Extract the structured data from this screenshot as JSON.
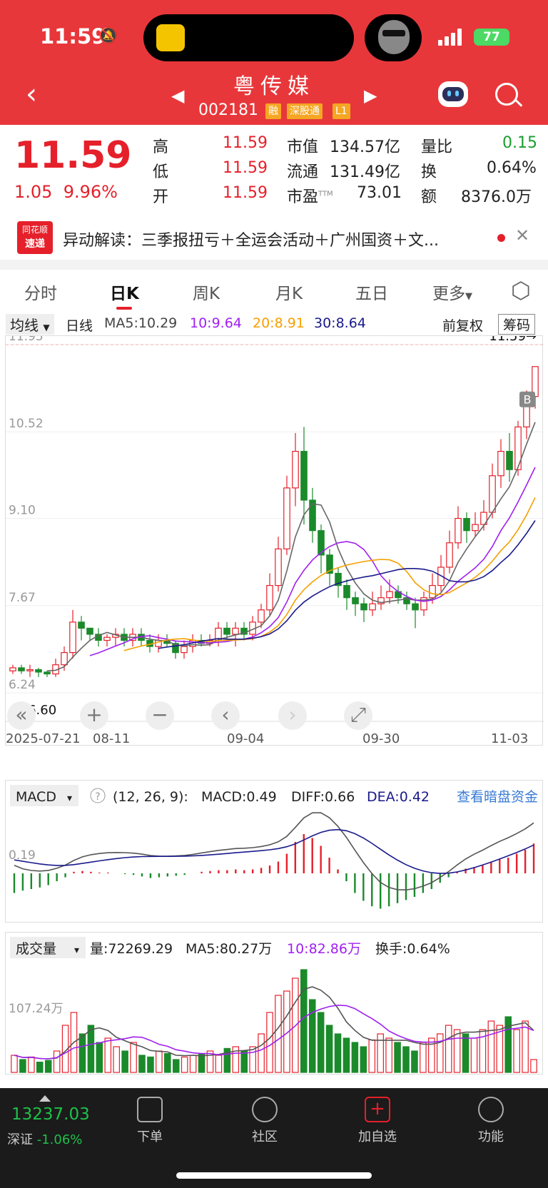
{
  "status": {
    "time": "11:59",
    "battery": "77"
  },
  "header": {
    "title": "粤传媒",
    "code": "002181",
    "tags": [
      "融",
      "深股通",
      "L1"
    ]
  },
  "quote": {
    "price": "11.59",
    "change": "1.05",
    "change_pct": "9.96%",
    "rows": [
      {
        "k1": "高",
        "v1": "11.59",
        "k2": "市值",
        "v2": "134.57亿",
        "k3": "量比",
        "v3": "0.15"
      },
      {
        "k1": "低",
        "v1": "11.59",
        "k2": "流通",
        "v2": "131.49亿",
        "k3": "换",
        "v3": "0.64%"
      },
      {
        "k1": "开",
        "v1": "11.59",
        "k2": "市盈",
        "k2sup": "TTM",
        "v2": "73.01",
        "k3": "额",
        "v3": "8376.0万"
      }
    ]
  },
  "news": {
    "logo_top": "同花顺",
    "logo_bottom": "速递",
    "text": "异动解读：三季报扭亏＋全运会活动＋广州国资＋文..."
  },
  "tabs": [
    "分时",
    "日K",
    "周K",
    "月K",
    "五日",
    "更多"
  ],
  "active_tab": "日K",
  "ma": {
    "selector": "均线",
    "period": "日线",
    "ma5": "MA5:10.29",
    "ma10": "10:9.64",
    "ma20": "20:8.91",
    "ma30": "30:8.64",
    "adjust": "前复权",
    "chips": "筹码"
  },
  "colors": {
    "up": "#e5202a",
    "down": "#1a8a2a",
    "ma5": "#666666",
    "ma10": "#a020f0",
    "ma20": "#f5a000",
    "ma30": "#1a1a8c"
  },
  "chart_data": {
    "type": "candlestick",
    "y_labels": [
      "11.95",
      "10.52",
      "9.10",
      "7.67",
      "6.24"
    ],
    "ylim": [
      6.24,
      11.95
    ],
    "last_price_label": "11.59→",
    "low_label": "←6.60",
    "dates": [
      "2025-07-21",
      "08-11",
      "09-04",
      "09-30",
      "11-03"
    ],
    "marker": "B",
    "candles": [
      [
        6.6,
        6.65,
        6.55,
        6.7
      ],
      [
        6.65,
        6.6,
        6.55,
        6.7
      ],
      [
        6.6,
        6.62,
        6.5,
        6.7
      ],
      [
        6.62,
        6.58,
        6.5,
        6.65
      ],
      [
        6.58,
        6.55,
        6.5,
        6.6
      ],
      [
        6.55,
        6.7,
        6.5,
        6.8
      ],
      [
        6.7,
        6.9,
        6.6,
        7.0
      ],
      [
        6.9,
        7.4,
        6.8,
        7.6
      ],
      [
        7.4,
        7.3,
        7.1,
        7.5
      ],
      [
        7.3,
        7.2,
        7.1,
        7.3
      ],
      [
        7.2,
        7.1,
        7.0,
        7.3
      ],
      [
        7.1,
        7.15,
        7.0,
        7.2
      ],
      [
        7.15,
        7.2,
        7.0,
        7.3
      ],
      [
        7.2,
        7.1,
        7.0,
        7.3
      ],
      [
        7.1,
        7.2,
        7.0,
        7.3
      ],
      [
        7.2,
        7.1,
        7.0,
        7.3
      ],
      [
        7.1,
        7.0,
        6.9,
        7.2
      ],
      [
        7.0,
        7.1,
        6.9,
        7.2
      ],
      [
        7.1,
        7.05,
        7.0,
        7.2
      ],
      [
        7.05,
        6.9,
        6.8,
        7.1
      ],
      [
        6.9,
        7.0,
        6.8,
        7.1
      ],
      [
        7.0,
        7.1,
        6.9,
        7.2
      ],
      [
        7.1,
        7.05,
        7.0,
        7.2
      ],
      [
        7.05,
        7.1,
        7.0,
        7.2
      ],
      [
        7.1,
        7.3,
        7.0,
        7.4
      ],
      [
        7.3,
        7.2,
        7.1,
        7.4
      ],
      [
        7.2,
        7.3,
        7.0,
        7.4
      ],
      [
        7.3,
        7.2,
        7.1,
        7.4
      ],
      [
        7.2,
        7.4,
        7.1,
        7.5
      ],
      [
        7.4,
        7.6,
        7.3,
        7.7
      ],
      [
        7.6,
        8.0,
        7.5,
        8.2
      ],
      [
        8.0,
        8.6,
        7.9,
        8.8
      ],
      [
        8.6,
        9.6,
        8.5,
        9.8
      ],
      [
        9.6,
        10.2,
        9.3,
        10.5
      ],
      [
        10.2,
        9.4,
        9.0,
        10.6
      ],
      [
        9.4,
        8.9,
        8.7,
        9.6
      ],
      [
        8.9,
        8.5,
        8.2,
        9.0
      ],
      [
        8.5,
        8.2,
        8.0,
        8.6
      ],
      [
        8.2,
        8.0,
        7.8,
        8.3
      ],
      [
        8.0,
        7.8,
        7.6,
        8.1
      ],
      [
        7.8,
        7.7,
        7.5,
        7.9
      ],
      [
        7.7,
        7.6,
        7.4,
        7.8
      ],
      [
        7.6,
        7.7,
        7.5,
        7.9
      ],
      [
        7.7,
        7.8,
        7.6,
        8.0
      ],
      [
        7.8,
        7.9,
        7.7,
        8.1
      ],
      [
        7.9,
        7.8,
        7.7,
        8.0
      ],
      [
        7.8,
        7.7,
        7.6,
        7.9
      ],
      [
        7.7,
        7.6,
        7.3,
        7.8
      ],
      [
        7.6,
        7.8,
        7.5,
        7.9
      ],
      [
        7.8,
        8.0,
        7.7,
        8.2
      ],
      [
        8.0,
        8.3,
        7.9,
        8.5
      ],
      [
        8.3,
        8.7,
        8.2,
        8.9
      ],
      [
        8.7,
        9.1,
        8.6,
        9.3
      ],
      [
        9.1,
        8.9,
        8.7,
        9.2
      ],
      [
        8.9,
        9.0,
        8.8,
        9.2
      ],
      [
        9.0,
        9.2,
        8.9,
        9.4
      ],
      [
        9.2,
        9.8,
        9.1,
        10.0
      ],
      [
        9.8,
        10.2,
        9.6,
        10.4
      ],
      [
        10.2,
        9.9,
        9.7,
        10.5
      ],
      [
        9.9,
        10.6,
        9.8,
        10.7
      ],
      [
        10.6,
        11.1,
        10.4,
        11.2
      ],
      [
        11.1,
        11.59,
        10.9,
        11.59
      ]
    ]
  },
  "macd": {
    "selector": "MACD",
    "params": "(12, 26, 9):",
    "macd": "MACD:0.49",
    "diff": "DIFF:0.66",
    "dea": "DEA:0.42",
    "link": "查看暗盘资金",
    "y_label": "0.19",
    "bars": [
      -0.25,
      -0.22,
      -0.2,
      -0.18,
      -0.15,
      -0.1,
      -0.05,
      0.02,
      0.03,
      0.02,
      0.01,
      0.01,
      0.0,
      -0.01,
      -0.02,
      -0.04,
      -0.06,
      -0.05,
      -0.04,
      -0.03,
      -0.02,
      0.0,
      0.02,
      0.03,
      0.04,
      0.04,
      0.05,
      0.04,
      0.05,
      0.07,
      0.1,
      0.15,
      0.25,
      0.4,
      0.5,
      0.45,
      0.35,
      0.2,
      0.05,
      -0.1,
      -0.25,
      -0.35,
      -0.42,
      -0.45,
      -0.42,
      -0.38,
      -0.34,
      -0.3,
      -0.25,
      -0.2,
      -0.12,
      -0.05,
      0.02,
      0.06,
      0.08,
      0.1,
      0.15,
      0.18,
      0.2,
      0.25,
      0.3,
      0.38
    ]
  },
  "volume": {
    "selector": "成交量",
    "vol": "量:72269.29",
    "ma5": "MA5:80.27万",
    "ma10": "10:82.86万",
    "turnover": "换手:0.64%",
    "y_label": "107.24万",
    "bars": [
      20,
      15,
      18,
      12,
      14,
      25,
      55,
      70,
      45,
      55,
      35,
      40,
      30,
      25,
      35,
      20,
      18,
      25,
      22,
      15,
      18,
      20,
      22,
      25,
      20,
      28,
      30,
      25,
      30,
      45,
      70,
      90,
      95,
      110,
      120,
      85,
      70,
      55,
      45,
      40,
      35,
      30,
      38,
      45,
      40,
      35,
      30,
      25,
      35,
      40,
      45,
      55,
      50,
      45,
      40,
      50,
      60,
      55,
      65,
      50,
      60,
      15
    ]
  },
  "bottom_nav": {
    "index_value": "13237.03",
    "index_name": "深证",
    "index_change": "-1.06%",
    "items": [
      "下单",
      "社区",
      "加自选",
      "功能"
    ]
  }
}
